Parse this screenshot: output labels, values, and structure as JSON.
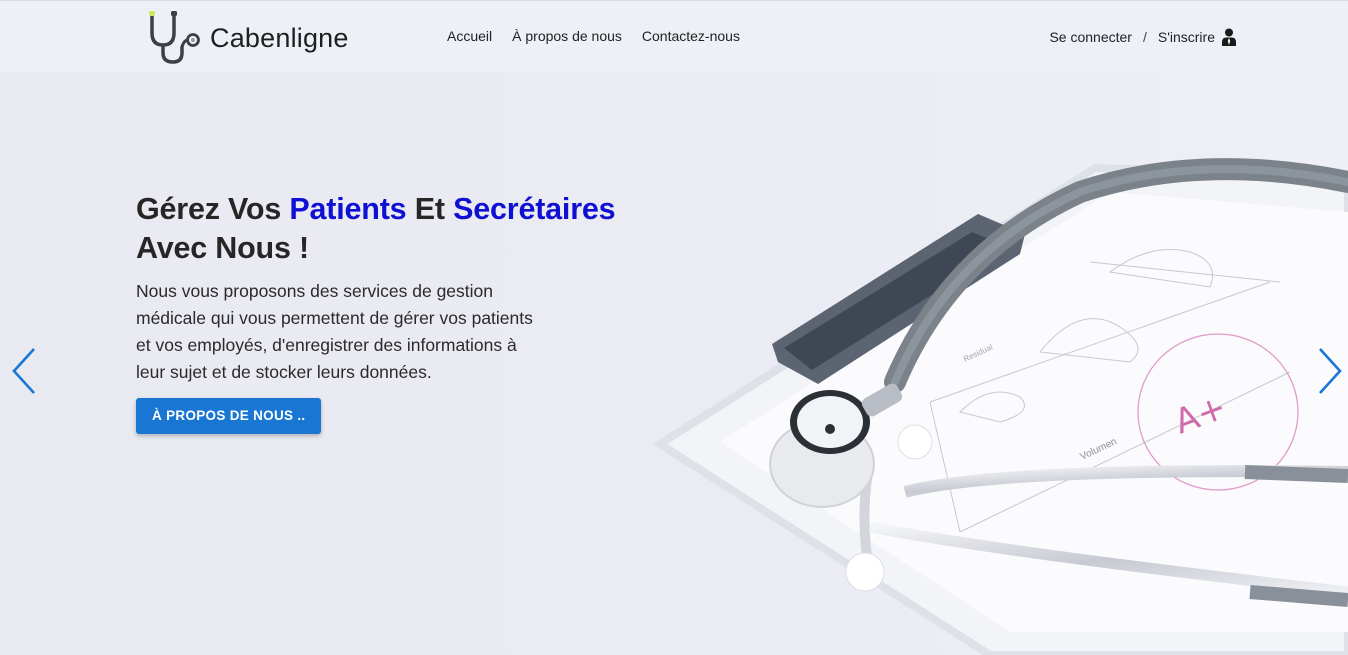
{
  "navbar": {
    "brand_name": "Cabenligne",
    "brand_logo_icon": "stethoscope-icon",
    "links": [
      {
        "label": "Accueil"
      },
      {
        "label": "À propos de nous"
      },
      {
        "label": "Contactez-nous"
      }
    ],
    "auth": {
      "login_label": "Se connecter",
      "separator": "/",
      "register_label": "S'inscrire",
      "user_icon": "user-icon"
    }
  },
  "hero": {
    "headline": {
      "part1": "Gérez Vos ",
      "highlight1": "Patients",
      "part2": " Et ",
      "highlight2": "Secrétaires",
      "part3": "Avec Nous !"
    },
    "description": "Nous vous proposons des services de gestion médicale qui vous permettent de gérer vos patients et vos employés, d'enregistrer des informations à leur sujet et de stocker leurs données.",
    "cta_label": "À PROPOS DE NOUS ..",
    "highlight_color": "#1010d4",
    "cta_color": "#1976d2",
    "prev_icon": "chevron-left-icon",
    "next_icon": "chevron-right-icon",
    "image_annotations": {
      "axis_label_1": "Volumen",
      "axis_label_2": "Residual",
      "handwritten_mark": "A+"
    }
  }
}
